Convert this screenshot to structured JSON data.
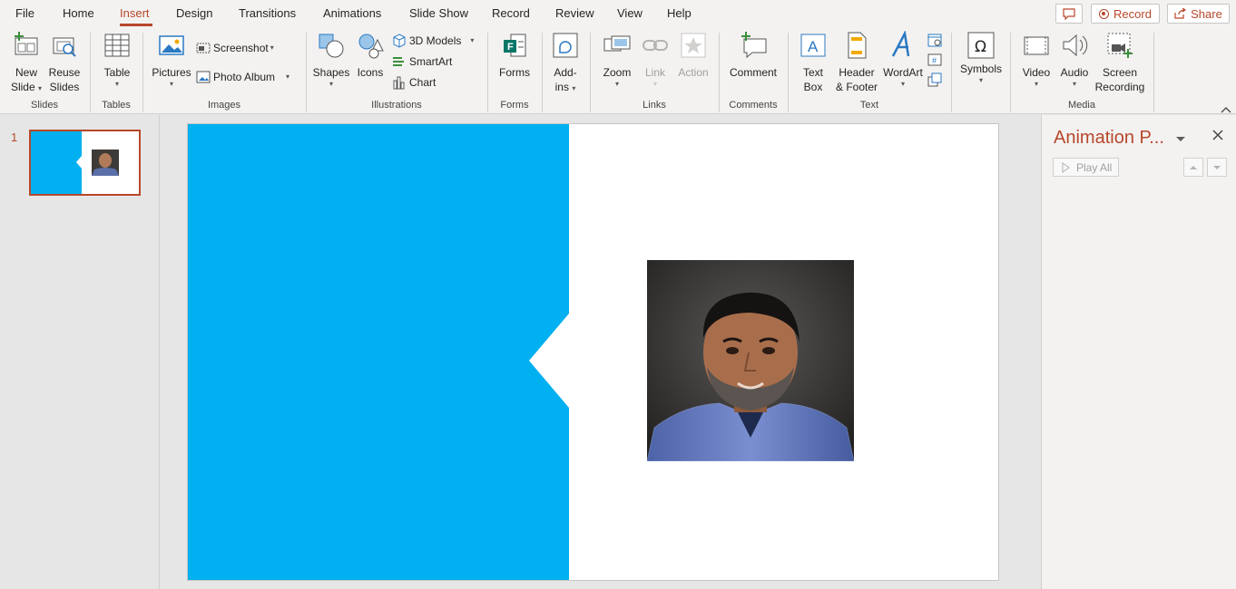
{
  "tabs": [
    {
      "label": "File"
    },
    {
      "label": "Home"
    },
    {
      "label": "Insert"
    },
    {
      "label": "Design"
    },
    {
      "label": "Transitions"
    },
    {
      "label": "Animations"
    },
    {
      "label": "Slide Show"
    },
    {
      "label": "Record"
    },
    {
      "label": "Review"
    },
    {
      "label": "View"
    },
    {
      "label": "Help"
    }
  ],
  "active_tab": "Insert",
  "topbar": {
    "record_label": "Record",
    "share_label": "Share"
  },
  "ribbon": {
    "slides": {
      "new_slide_1": "New",
      "new_slide_2": "Slide",
      "reuse_1": "Reuse",
      "reuse_2": "Slides",
      "group": "Slides"
    },
    "tables": {
      "table": "Table",
      "group": "Tables"
    },
    "images": {
      "pictures": "Pictures",
      "screenshot": "Screenshot",
      "photo_album": "Photo Album",
      "group": "Images"
    },
    "illustrations": {
      "shapes": "Shapes",
      "icons": "Icons",
      "models": "3D Models",
      "smartart": "SmartArt",
      "chart": "Chart",
      "group": "Illustrations"
    },
    "forms": {
      "forms": "Forms",
      "group": "Forms"
    },
    "addins": {
      "l1": "Add-",
      "l2": "ins"
    },
    "links": {
      "zoom": "Zoom",
      "link": "Link",
      "action": "Action",
      "group": "Links"
    },
    "comments": {
      "comment": "Comment",
      "group": "Comments"
    },
    "text": {
      "textbox_1": "Text",
      "textbox_2": "Box",
      "hf_1": "Header",
      "hf_2": "& Footer",
      "wordart": "WordArt",
      "group": "Text"
    },
    "symbols": {
      "symbols": "Symbols"
    },
    "media": {
      "video": "Video",
      "audio": "Audio",
      "sr_1": "Screen",
      "sr_2": "Recording",
      "group": "Media"
    }
  },
  "slides_pane": {
    "slide_number": "1"
  },
  "slide": {
    "accent_color": "#00b0f0"
  },
  "animation_pane": {
    "title": "Animation P...",
    "play_all": "Play All"
  },
  "colors": {
    "accent": "#b7472a",
    "slide_blue": "#00b0f0"
  }
}
